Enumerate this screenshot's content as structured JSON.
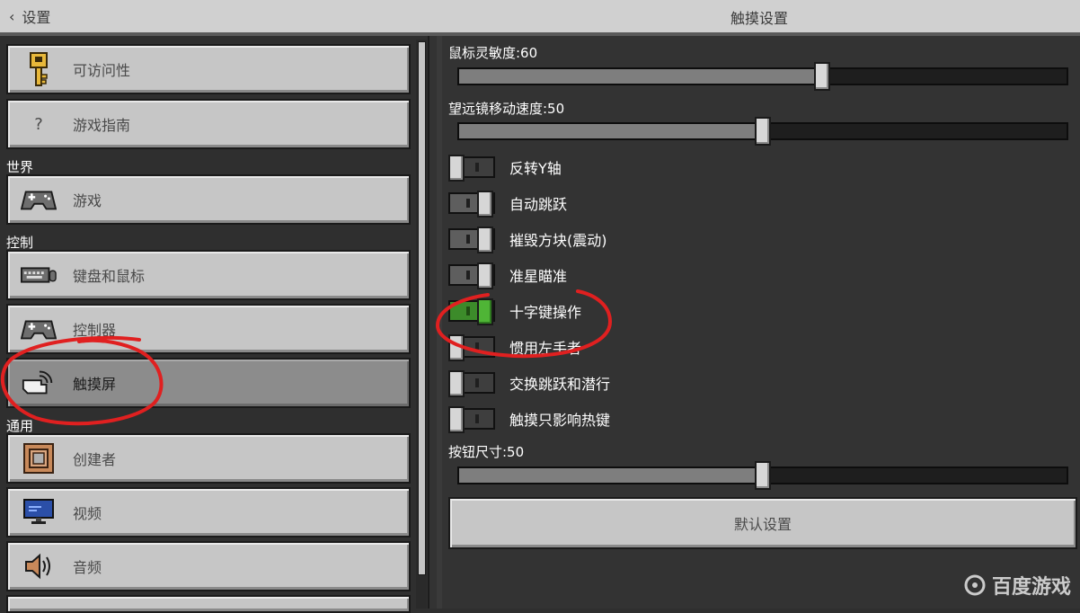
{
  "header": {
    "back_label": "设置",
    "title": "触摸设置"
  },
  "sidebar": {
    "items_top": [
      {
        "label": "可访问性",
        "icon": "key-icon"
      },
      {
        "label": "游戏指南",
        "icon": "question-icon",
        "glyph": "?"
      }
    ],
    "sections": [
      {
        "title": "世界",
        "items": [
          {
            "label": "游戏",
            "icon": "gamepad-icon"
          }
        ]
      },
      {
        "title": "控制",
        "items": [
          {
            "label": "键盘和鼠标",
            "icon": "keyboard-icon"
          },
          {
            "label": "控制器",
            "icon": "controller-icon"
          },
          {
            "label": "触摸屏",
            "icon": "touch-icon",
            "selected": true
          }
        ]
      },
      {
        "title": "通用",
        "items": [
          {
            "label": "创建者",
            "icon": "creator-icon"
          },
          {
            "label": "视频",
            "icon": "monitor-icon"
          },
          {
            "label": "音频",
            "icon": "speaker-icon"
          }
        ]
      }
    ]
  },
  "settings": {
    "mouse_sensitivity": {
      "label": "鼠标灵敏度:60",
      "value": 60,
      "max": 100
    },
    "telescope_speed": {
      "label": "望远镜移动速度:50",
      "value": 50,
      "max": 100
    },
    "toggles": [
      {
        "label": "反转Y轴",
        "state": "off"
      },
      {
        "label": "自动跳跃",
        "state": "on"
      },
      {
        "label": "摧毁方块(震动)",
        "state": "on"
      },
      {
        "label": "准星瞄准",
        "state": "on"
      },
      {
        "label": "十字键操作",
        "state": "on",
        "accent": "green"
      },
      {
        "label": "惯用左手者",
        "state": "off"
      },
      {
        "label": "交换跳跃和潜行",
        "state": "off"
      },
      {
        "label": "触摸只影响热键",
        "state": "off"
      }
    ],
    "button_size": {
      "label": "按钮尺寸:50",
      "value": 50,
      "max": 100
    },
    "default_button": "默认设置"
  },
  "watermark": {
    "text": "百度游戏"
  },
  "colors": {
    "annotation": "#e02020",
    "toggle_green": "#4fb536"
  }
}
